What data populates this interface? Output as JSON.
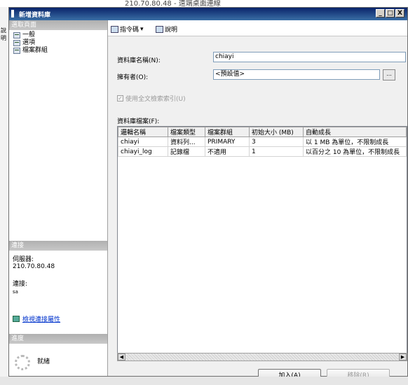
{
  "background": {
    "top_text": "210.70.80.48 - 遠端桌面連線",
    "left_text": "說明"
  },
  "window": {
    "title": "新增資料庫",
    "controls": [
      "_",
      "□",
      "X"
    ]
  },
  "left_pane": {
    "select_page_header": "選取頁面",
    "pages": [
      {
        "label": "一般",
        "icon": "page-icon"
      },
      {
        "label": "選項",
        "icon": "page-icon"
      },
      {
        "label": "檔案群組",
        "icon": "page-icon"
      }
    ],
    "connection_header": "連接",
    "server_label": "伺服器:",
    "server_value": "210.70.80.48",
    "connection_label": "連接:",
    "connection_value": "sa",
    "view_props_link": "檢視連接屬性",
    "progress_header": "進度",
    "progress_status": "就緒"
  },
  "toolbar": {
    "script_label": "指令碼",
    "help_label": "說明"
  },
  "form": {
    "db_name_label": "資料庫名稱(N):",
    "db_name_value": "chiayi",
    "owner_label": "擁有者(O):",
    "owner_value": "<預設值>",
    "ellipsis": "...",
    "fulltext_label": "使用全文檢索索引(U)",
    "fulltext_checked": true,
    "files_label": "資料庫檔案(F):"
  },
  "files_table": {
    "columns": [
      "邏輯名稱",
      "檔案類型",
      "檔案群組",
      "初始大小 (MB)",
      "自動成長"
    ],
    "rows": [
      [
        "chiayi",
        "資料列...",
        "PRIMARY",
        "3",
        "以 1 MB 為單位，不限制成長"
      ],
      [
        "chiayi_log",
        "記錄檔",
        "不適用",
        "1",
        "以百分之 10 為單位，不限制成長"
      ]
    ]
  },
  "buttons": {
    "add": "加入(A)",
    "remove": "移除(R)"
  },
  "colors": {
    "title_bar": "#0a246a",
    "link": "#0033cc",
    "section_header": "#b0b0b0"
  }
}
